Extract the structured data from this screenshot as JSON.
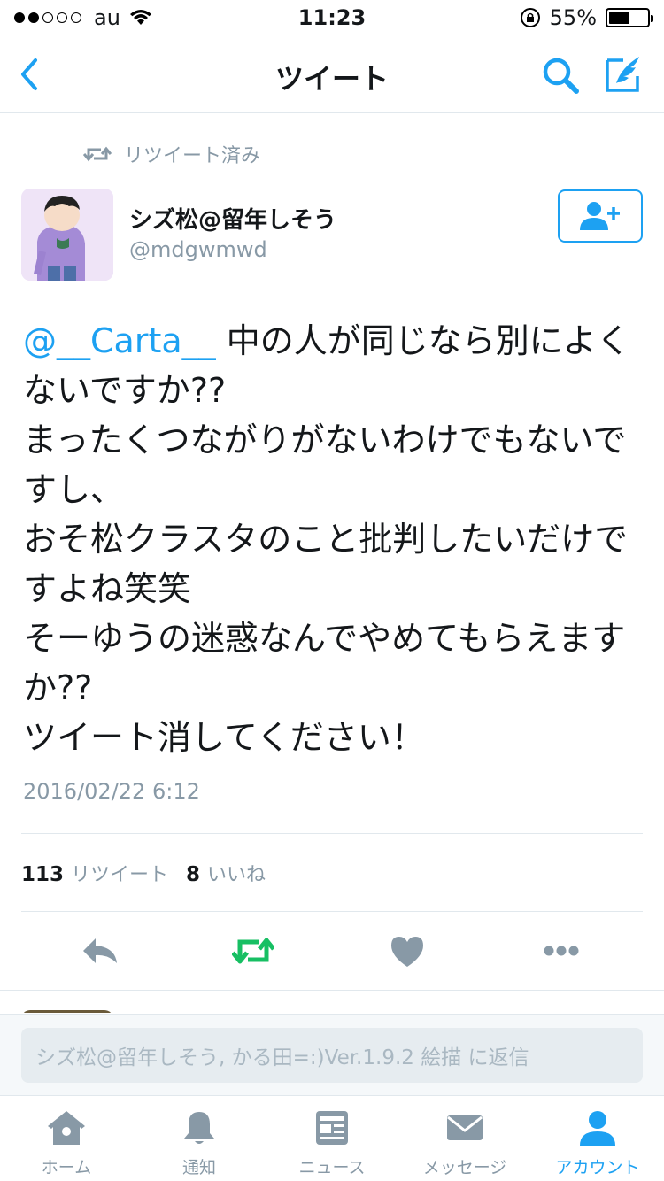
{
  "status_bar": {
    "carrier": "au",
    "time": "11:23",
    "battery_percent": "55%",
    "battery_level": 0.55,
    "signal_bars_filled": 2,
    "signal_bars_total": 5
  },
  "nav": {
    "title": "ツイート"
  },
  "retweet_banner": {
    "label": "リツイート済み"
  },
  "user": {
    "name": "シズ松@留年しそう",
    "handle": "@mdgwmwd"
  },
  "tweet": {
    "mention": "@__Carta__",
    "body": " 中の人が同じなら別によくないですか??\nまったくつながりがないわけでもないですし、\nおそ松クラスタのこと批判したいだけですよね笑笑\nそーゆうの迷惑なんでやめてもらえますか??\nツイート消してください！",
    "timestamp": "2016/02/22 6:12"
  },
  "counts": {
    "retweet_count": "113",
    "retweet_label": "リツイート",
    "like_count": "8",
    "like_label": "いいね"
  },
  "reply": {
    "placeholder": "シズ松@留年しそう, かる田=:)Ver.1.9.2 絵描 に返信"
  },
  "tabs": [
    {
      "label": "ホーム",
      "icon": "home-icon"
    },
    {
      "label": "通知",
      "icon": "bell-icon"
    },
    {
      "label": "ニュース",
      "icon": "news-icon"
    },
    {
      "label": "メッセージ",
      "icon": "envelope-icon"
    },
    {
      "label": "アカウント",
      "icon": "person-icon"
    }
  ],
  "colors": {
    "accent": "#1da1f2",
    "retweet_active": "#17bf63",
    "muted": "#8899a6"
  }
}
